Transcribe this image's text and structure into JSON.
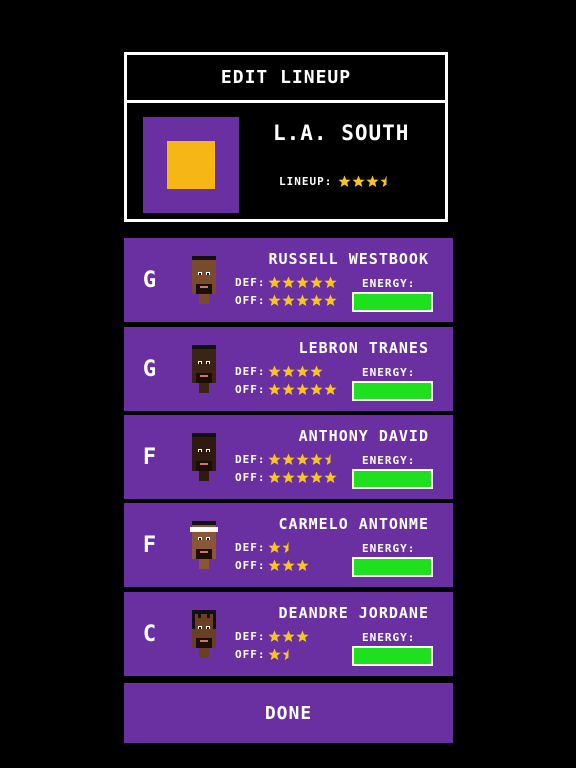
{
  "header": {
    "title": "EDIT LINEUP",
    "team_name": "L.A. SOUTH",
    "lineup_label": "LINEUP:",
    "lineup_rating": 3.5,
    "logo_colors": {
      "outer": "#6a2fa0",
      "inner": "#f6b716"
    }
  },
  "labels": {
    "def": "DEF:",
    "off": "OFF:",
    "energy": "ENERGY:"
  },
  "players": [
    {
      "position": "G",
      "name": "RUSSELL WESTBOOK",
      "def_rating": 5,
      "off_rating": 5,
      "energy": 1.0
    },
    {
      "position": "G",
      "name": "LEBRON TRANES",
      "def_rating": 4,
      "off_rating": 5,
      "energy": 1.0
    },
    {
      "position": "F",
      "name": "ANTHONY DAVID",
      "def_rating": 4.5,
      "off_rating": 5,
      "energy": 1.0
    },
    {
      "position": "F",
      "name": "CARMELO ANTONME",
      "def_rating": 1.5,
      "off_rating": 3,
      "energy": 1.0
    },
    {
      "position": "C",
      "name": "DEANDRE JORDANE",
      "def_rating": 3,
      "off_rating": 1.5,
      "energy": 1.0
    }
  ],
  "done_label": "DONE",
  "colors": {
    "card_purple": "#6a2fa0",
    "star_gold": "#f6c61e",
    "energy_green": "#1ee01e"
  }
}
